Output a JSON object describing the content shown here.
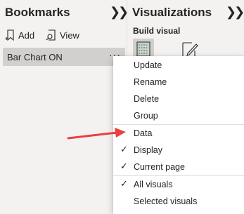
{
  "bookmarks_pane": {
    "title": "Bookmarks",
    "add_label": "Add",
    "view_label": "View",
    "items": [
      {
        "label": "Bar Chart ON",
        "more": "···"
      }
    ]
  },
  "visualizations_pane": {
    "title": "Visualizations",
    "build_visual_label": "Build visual"
  },
  "context_menu": {
    "items": [
      {
        "label": "Update",
        "checked": false
      },
      {
        "label": "Rename",
        "checked": false
      },
      {
        "label": "Delete",
        "checked": false
      },
      {
        "label": "Group",
        "checked": false
      },
      {
        "label": "Data",
        "checked": false
      },
      {
        "label": "Display",
        "checked": true
      },
      {
        "label": "Current page",
        "checked": true
      },
      {
        "label": "All visuals",
        "checked": true
      },
      {
        "label": "Selected visuals",
        "checked": false
      }
    ],
    "check_glyph": "✓"
  },
  "annotation": {
    "arrow_color": "#e8403d",
    "points_to": "Data"
  },
  "colors": {
    "pane_background": "#f3f2f1",
    "selected_item": "#d2d0ce",
    "menu_background": "#ffffff"
  }
}
